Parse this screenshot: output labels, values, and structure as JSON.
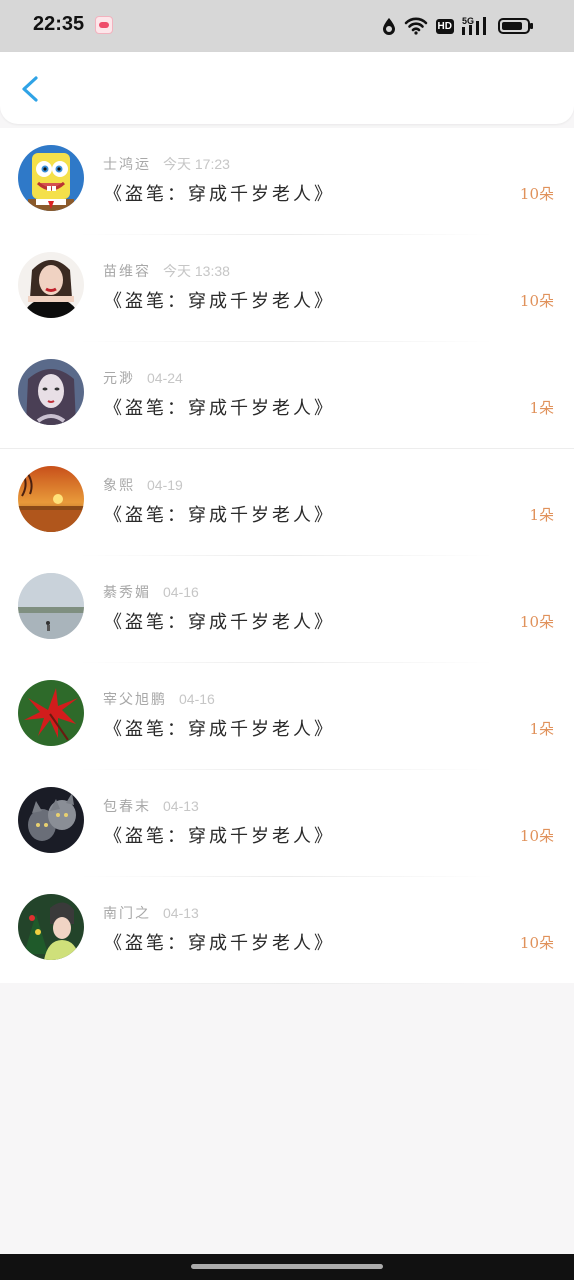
{
  "status_bar": {
    "time": "22:35",
    "hd": "HD",
    "network": "5G",
    "icons": [
      "app-notification-icon",
      "data-saver-icon",
      "wifi-icon",
      "hd-icon",
      "signal-5g-icon",
      "battery-icon"
    ]
  },
  "header": {
    "back_icon": "chevron-left-icon",
    "accent": "#2fa3e6"
  },
  "rows": [
    {
      "name": "士鸿运",
      "time": "今天 17:23",
      "title": "《盗笔：穿成千岁老人》",
      "count": "10朵"
    },
    {
      "name": "苗维容",
      "time": "今天 13:38",
      "title": "《盗笔：穿成千岁老人》",
      "count": "10朵"
    },
    {
      "name": "元渺",
      "time": "04-24",
      "title": "《盗笔：穿成千岁老人》",
      "count": "1朵"
    },
    {
      "name": "象熙",
      "time": "04-19",
      "title": "《盗笔：穿成千岁老人》",
      "count": "1朵"
    },
    {
      "name": "綦秀媚",
      "time": "04-16",
      "title": "《盗笔：穿成千岁老人》",
      "count": "10朵"
    },
    {
      "name": "宰父旭鹏",
      "time": "04-16",
      "title": "《盗笔：穿成千岁老人》",
      "count": "1朵"
    },
    {
      "name": "包春末",
      "time": "04-13",
      "title": "《盗笔：穿成千岁老人》",
      "count": "10朵"
    },
    {
      "name": "南门之",
      "time": "04-13",
      "title": "《盗笔：穿成千岁老人》",
      "count": "10朵"
    }
  ],
  "colors": {
    "count": "#e0915a",
    "name": "#a8a8a8",
    "title": "#2a2a2a",
    "background": "#f7f6f7"
  }
}
